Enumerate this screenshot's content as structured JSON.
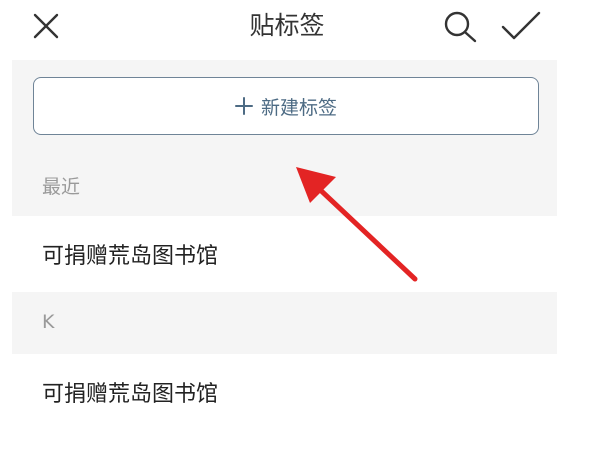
{
  "header": {
    "title": "贴标签",
    "icons": [
      "close-icon",
      "search-icon",
      "check-icon"
    ]
  },
  "new_tag_button": {
    "label": "新建标签"
  },
  "sections": [
    {
      "header": "最近",
      "items": [
        "可捐赠荒岛图书馆"
      ]
    },
    {
      "header": "K",
      "items": [
        "可捐赠荒岛图书馆"
      ]
    }
  ],
  "colors": {
    "accent": "#4d6b84",
    "border": "#6f8497",
    "section_bg": "#f5f5f5",
    "section_text": "#9a9a9a",
    "annotation_arrow": "#e32424"
  }
}
